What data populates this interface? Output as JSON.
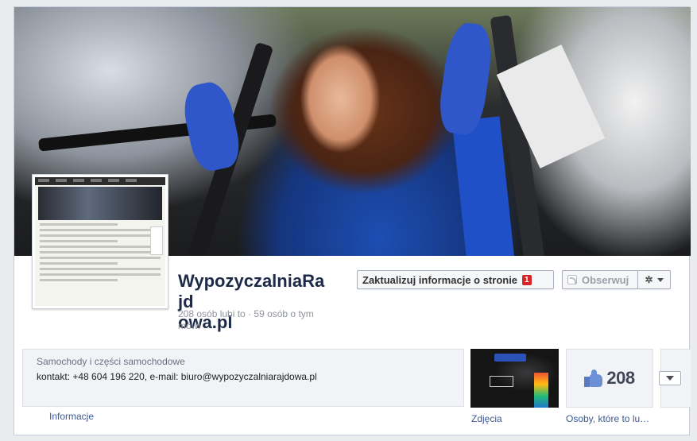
{
  "page": {
    "name": "WypozyczalniaRajdowa.pl",
    "name_line1": "WypozyczalniaRajd",
    "name_line2": "owa.pl",
    "likes_text": "208 osób lubi to · 59 osób o tym mówi"
  },
  "buttons": {
    "update_label": "Zaktualizuj informacje o stronie",
    "update_badge": "1",
    "follow_label": "Obserwuj",
    "gear_icon": "gear-icon"
  },
  "about": {
    "category": "Samochody i części samochodowe",
    "contact": "kontakt: +48 604 196 220, e-mail: biuro@wypozyczalniarajdowa.pl"
  },
  "tabs": {
    "info": "Informacje",
    "photos": "Zdjęcia",
    "people": "Osoby, które to lu…",
    "likes_count": "208"
  },
  "colors": {
    "link": "#3b5998",
    "name": "#1c2a47",
    "badge": "#d8232b"
  }
}
